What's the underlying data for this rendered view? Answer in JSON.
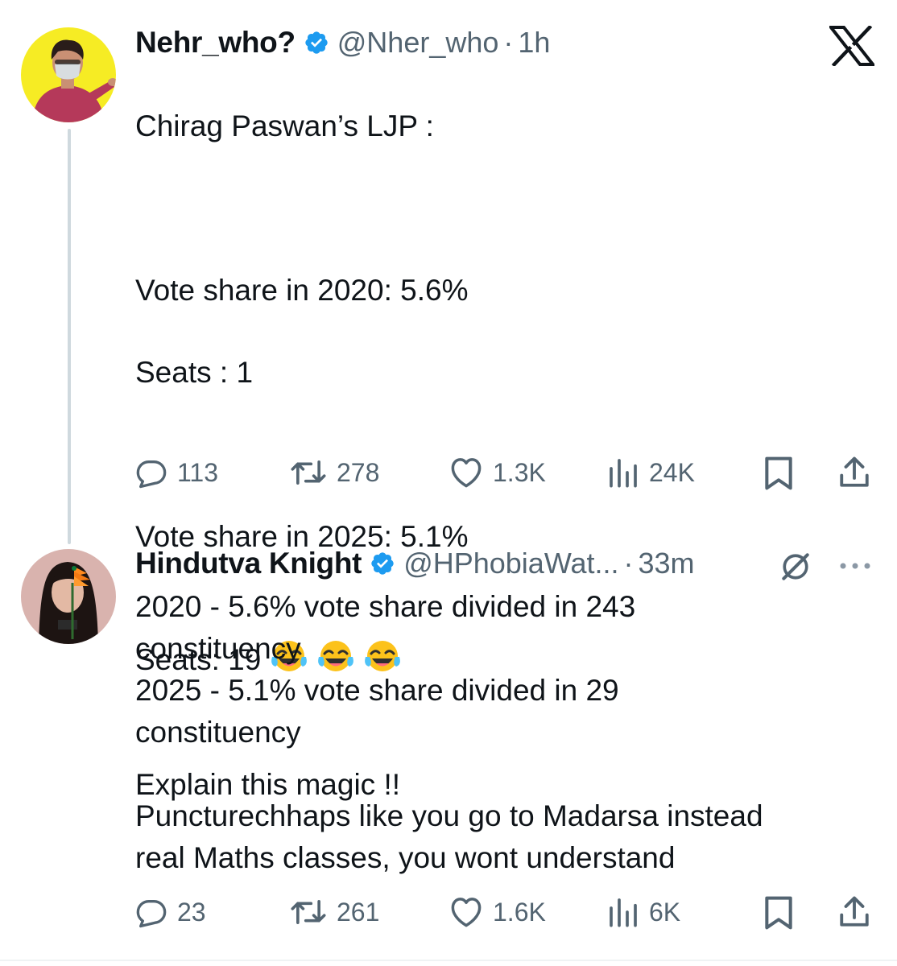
{
  "tweet1": {
    "display_name": "Nehr_who?",
    "handle": "@Nher_who",
    "separator": "·",
    "time": "1h",
    "text_lines": [
      "Chirag Paswan’s LJP :",
      "",
      "Vote share in 2020: 5.6%",
      "Seats : 1",
      "",
      "Vote share in 2025: 5.1%"
    ],
    "seats_line": "Seats: 19",
    "emoji_count": 3,
    "closing_line": "Explain this magic !!",
    "replies": "113",
    "reposts": "278",
    "likes": "1.3K",
    "views": "24K"
  },
  "tweet2": {
    "display_name": "Hindutva Knight",
    "handle": "@HPhobiaWat...",
    "separator": "·",
    "time": "33m",
    "text": "2020 - 5.6% vote share divided in 243\nconstituency\n2025 - 5.1% vote share divided in 29\nconstituency\n\nPuncturechhaps like you go to Madarsa instead\nreal Maths classes, you wont understand",
    "replies": "23",
    "reposts": "261",
    "likes": "1.6K",
    "views": "6K"
  },
  "colors": {
    "text": "#0f1419",
    "secondary": "#536471",
    "verified": "#1d9bf0",
    "thread_line": "#cfd9de"
  },
  "icons": [
    "x-logo-icon",
    "verified-badge-icon",
    "reply-icon",
    "repost-icon",
    "like-icon",
    "views-icon",
    "bookmark-icon",
    "share-icon",
    "grok-icon",
    "more-icon",
    "laughing-tears-emoji"
  ]
}
